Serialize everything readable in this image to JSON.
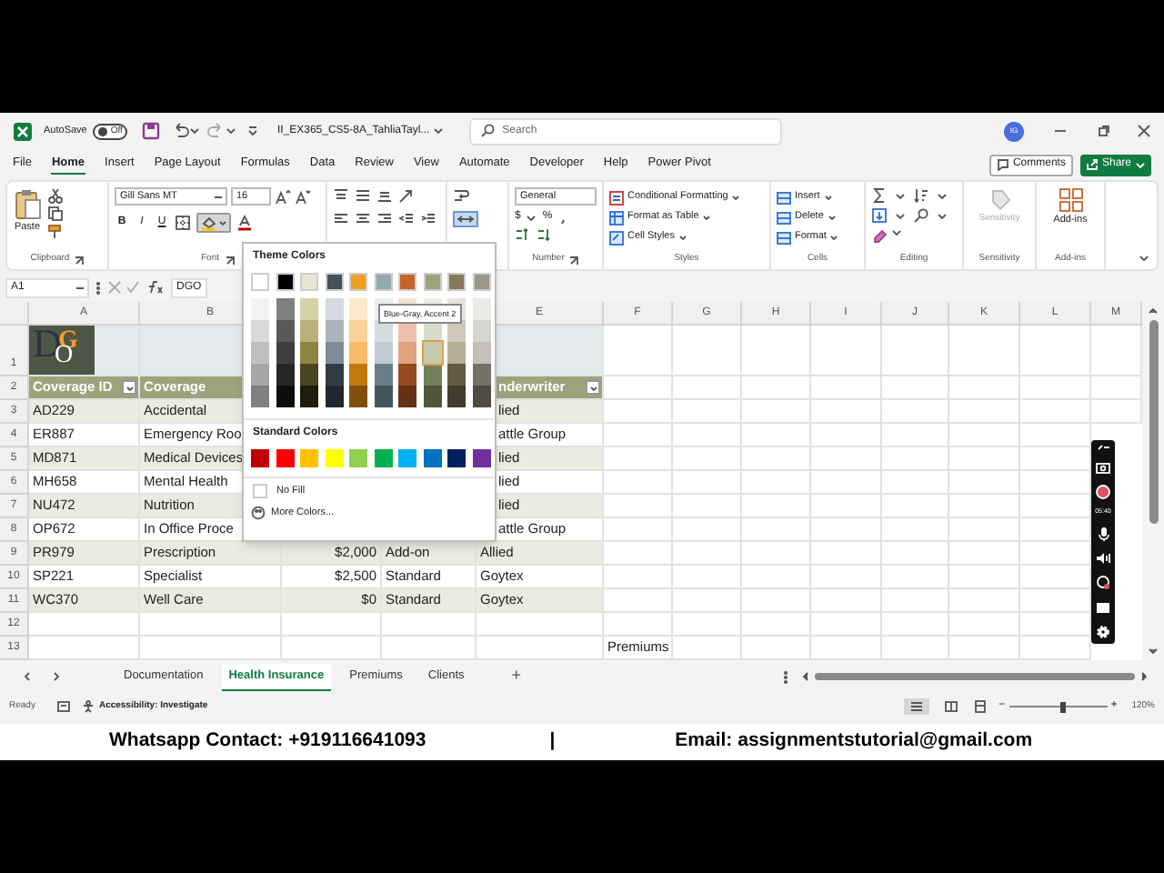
{
  "title_bar": {
    "autosave_label": "AutoSave",
    "autosave_on": false,
    "autosave_state": "Off",
    "file_name": "II_EX365_CS5-8A_TahliaTayl...",
    "search_placeholder": "Search",
    "avatar": "IG"
  },
  "ribbon_tabs": [
    {
      "label": "File",
      "selected": false
    },
    {
      "label": "Home",
      "selected": true
    },
    {
      "label": "Insert",
      "selected": false
    },
    {
      "label": "Page Layout",
      "selected": false
    },
    {
      "label": "Formulas",
      "selected": false
    },
    {
      "label": "Data",
      "selected": false
    },
    {
      "label": "Review",
      "selected": false
    },
    {
      "label": "View",
      "selected": false
    },
    {
      "label": "Automate",
      "selected": false
    },
    {
      "label": "Developer",
      "selected": false
    },
    {
      "label": "Help",
      "selected": false
    },
    {
      "label": "Power Pivot",
      "selected": false
    }
  ],
  "comments_button": "Comments",
  "share_button": "Share",
  "ribbon": {
    "paste": "Paste",
    "clipboard_label": "Clipboard",
    "font_name": "Gill Sans MT",
    "font_size": "16",
    "bold": "B",
    "italic": "I",
    "underline": "U",
    "fill_menu_open": true,
    "font_label": "Font",
    "number_format": "General",
    "currency": "$",
    "percent": "%",
    "number_label": "Number",
    "styles": [
      "Conditional Formatting",
      "Format as Table",
      "Cell Styles"
    ],
    "styles_label": "Styles",
    "cells": [
      "Insert",
      "Delete",
      "Format"
    ],
    "cells_label": "Cells",
    "editing_label": "Editing",
    "sensitivity": "Sensitivity",
    "sensitivity_disabled": true,
    "sensitivity_label": "Sensitivity",
    "add_ins": "Add-ins",
    "add_ins_label": "Add-ins"
  },
  "formula_bar": {
    "name_box": "A1",
    "content": "DGO"
  },
  "columns": [
    "A",
    "B",
    "E",
    "F",
    "G",
    "H",
    "I",
    "J",
    "K",
    "L",
    "M"
  ],
  "logo": {
    "letters": [
      "D",
      "G",
      "O"
    ]
  },
  "rows": [
    {
      "number": "1",
      "kind": "logo"
    },
    {
      "number": "2",
      "kind": "header",
      "a": "Coverage ID",
      "b": "Coverage",
      "e": "nderwriter"
    },
    {
      "number": "3",
      "kind": "data",
      "a": "AD229",
      "b": "Accidental",
      "e": "lied"
    },
    {
      "number": "4",
      "kind": "data",
      "a": "ER887",
      "b": "Emergency Roo",
      "e": "attle Group"
    },
    {
      "number": "5",
      "kind": "data",
      "a": "MD871",
      "b": "Medical Devices",
      "e": "lied"
    },
    {
      "number": "6",
      "kind": "data",
      "a": "MH658",
      "b": "Mental Health",
      "e": "lied"
    },
    {
      "number": "7",
      "kind": "data",
      "a": "NU472",
      "b": "Nutrition",
      "e": "lied"
    },
    {
      "number": "8",
      "kind": "data",
      "a": "OP672",
      "b": "In Office Proce",
      "e": "attle Group"
    },
    {
      "number": "9",
      "kind": "data",
      "a": "PR979",
      "b": "Prescription",
      "c": "$2,000",
      "d": "Add-on",
      "e": "Allied"
    },
    {
      "number": "10",
      "kind": "data",
      "a": "SP221",
      "b": "Specialist",
      "c": "$2,500",
      "d": "Standard",
      "e": "Goytex"
    },
    {
      "number": "11",
      "kind": "data",
      "a": "WC370",
      "b": "Well Care",
      "c": "$0",
      "d": "Standard",
      "e": "Goytex"
    },
    {
      "number": "12",
      "kind": "blank"
    },
    {
      "number": "13",
      "kind": "blank",
      "f": "Premiums"
    }
  ],
  "color_picker": {
    "theme_title": "Theme Colors",
    "theme": [
      {
        "color": "#ffffff",
        "shades": [
          {
            "color": "#f2f2f2",
            "selected": false
          },
          {
            "color": "#d9d9d9",
            "selected": false
          },
          {
            "color": "#bfbfbf",
            "selected": false
          },
          {
            "color": "#a6a6a6",
            "selected": false
          },
          {
            "color": "#808080",
            "selected": false
          }
        ]
      },
      {
        "color": "#000000",
        "shades": [
          {
            "color": "#7f7f7f",
            "selected": false
          },
          {
            "color": "#595959",
            "selected": false
          },
          {
            "color": "#3f3f3f",
            "selected": false
          },
          {
            "color": "#262626",
            "selected": false
          },
          {
            "color": "#0d0d0d",
            "selected": false
          }
        ]
      },
      {
        "color": "#e8e4d4",
        "shades": [
          {
            "color": "#d6d2a8",
            "selected": false
          },
          {
            "color": "#b8b078",
            "selected": false
          },
          {
            "color": "#8c8440",
            "selected": false
          },
          {
            "color": "#4a4420",
            "selected": false
          },
          {
            "color": "#1e1c0c",
            "selected": false
          }
        ]
      },
      {
        "color": "#44505a",
        "shades": [
          {
            "color": "#d4dadf",
            "selected": false
          },
          {
            "color": "#aab4bd",
            "selected": false
          },
          {
            "color": "#7e8c98",
            "selected": false
          },
          {
            "color": "#333c44",
            "selected": false
          },
          {
            "color": "#222830",
            "selected": false
          }
        ]
      },
      {
        "color": "#f0a020",
        "shades": [
          {
            "color": "#fce8cc",
            "selected": false
          },
          {
            "color": "#f9d199",
            "selected": false
          },
          {
            "color": "#f6bb66",
            "selected": false
          },
          {
            "color": "#c07810",
            "selected": false
          },
          {
            "color": "#80500a",
            "selected": false
          }
        ]
      },
      {
        "color": "#94a8b0",
        "shades": [
          {
            "color": "#e9eef0",
            "selected": false
          },
          {
            "color": "#d4dcdf",
            "selected": false
          },
          {
            "color": "#bfcbd0",
            "selected": false
          },
          {
            "color": "#6a8088",
            "selected": false
          },
          {
            "color": "#46555b",
            "selected": false
          }
        ]
      },
      {
        "color": "#c8642a",
        "shades": [
          {
            "color": "#f5e0d4",
            "selected": false
          },
          {
            "color": "#ebc1aa",
            "selected": false
          },
          {
            "color": "#e0a27f",
            "selected": false
          },
          {
            "color": "#964a1f",
            "selected": false
          },
          {
            "color": "#643114",
            "selected": false
          }
        ]
      },
      {
        "color": "#9ca47c",
        "shades": [
          {
            "color": "#ebede4",
            "selected": false
          },
          {
            "color": "#d7dbc9",
            "selected": false
          },
          {
            "color": "#c4c9af",
            "selected": true
          },
          {
            "color": "#74805a",
            "selected": false
          },
          {
            "color": "#4e563c",
            "selected": false
          }
        ]
      },
      {
        "color": "#857a58",
        "shades": [
          {
            "color": "#e7e4dc",
            "selected": false
          },
          {
            "color": "#cfc9b9",
            "selected": false
          },
          {
            "color": "#b7ae96",
            "selected": false
          },
          {
            "color": "#645b42",
            "selected": false
          },
          {
            "color": "#423c2c",
            "selected": false
          }
        ]
      },
      {
        "color": "#9a968a",
        "shades": [
          {
            "color": "#ebeae7",
            "selected": false
          },
          {
            "color": "#d7d5d0",
            "selected": false
          },
          {
            "color": "#c2c0b9",
            "selected": false
          },
          {
            "color": "#757166",
            "selected": false
          },
          {
            "color": "#4e4b44",
            "selected": false
          }
        ]
      }
    ],
    "tooltip": "Blue-Gray, Accent 2",
    "standard_title": "Standard Colors",
    "standard": [
      {
        "color": "#c00000"
      },
      {
        "color": "#ff0000"
      },
      {
        "color": "#ffc000"
      },
      {
        "color": "#ffff00"
      },
      {
        "color": "#92d050"
      },
      {
        "color": "#00b050"
      },
      {
        "color": "#00b0f0"
      },
      {
        "color": "#0070c0"
      },
      {
        "color": "#002060"
      },
      {
        "color": "#7030a0"
      }
    ],
    "no_fill": "No Fill",
    "more_colors": "More Colors..."
  },
  "recorder": {
    "time": "05:40"
  },
  "sheet_tabs": [
    {
      "label": "Documentation",
      "selected": false
    },
    {
      "label": "Health Insurance",
      "selected": true
    },
    {
      "label": "Premiums",
      "selected": false
    },
    {
      "label": "Clients",
      "selected": false
    }
  ],
  "add_sheet": "+",
  "status_bar": {
    "ready": "Ready",
    "accessibility": "Accessibility: Investigate",
    "zoom_out": "−",
    "zoom_in": "+",
    "zoom": "120%",
    "level": 0.55
  },
  "banner": {
    "whatsapp": "Whatsapp Contact: +919116641093",
    "separator": "|",
    "email": "Email: assignmentstutorial@gmail.com"
  }
}
